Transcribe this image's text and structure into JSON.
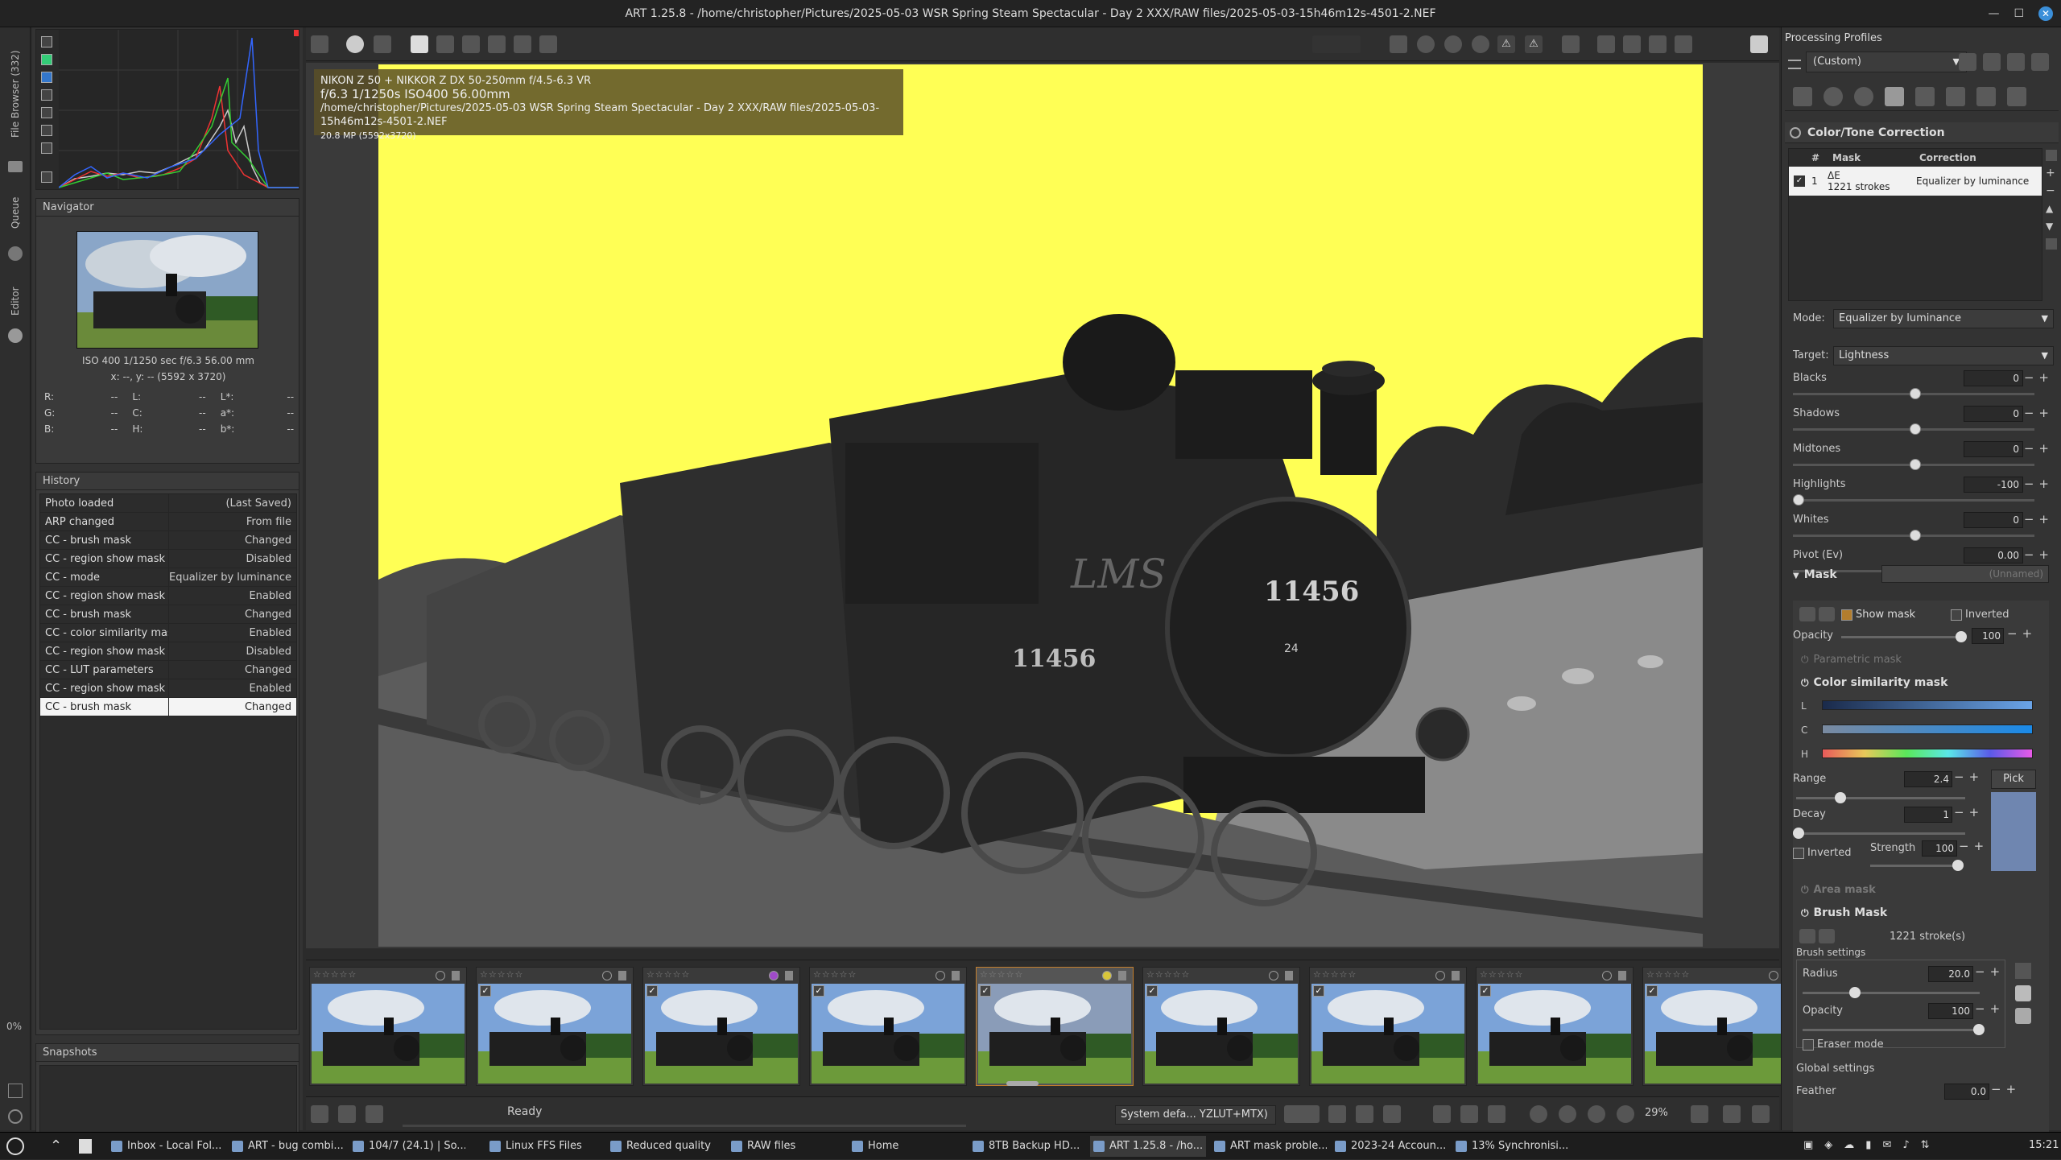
{
  "window": {
    "title": "ART 1.25.8 - /home/christopher/Pictures/2025-05-03 WSR Spring Steam Spectacular - Day 2 XXX/RAW files/2025-05-03-15h46m12s-4501-2.NEF"
  },
  "vtabs": {
    "file_browser": "File Browser (332)",
    "queue": "Queue",
    "editor": "Editor",
    "percent": "0%"
  },
  "navigator": {
    "title": "Navigator",
    "exif": "ISO 400   1/1250 sec   f/6.3   56.00 mm",
    "coords": "x: --, y: --     (5592 x 3720)",
    "rows": [
      {
        "a": "R:",
        "av": "--",
        "b": "L:",
        "bv": "--",
        "c": "L*:",
        "cv": "--"
      },
      {
        "a": "G:",
        "av": "--",
        "b": "C:",
        "bv": "--",
        "c": "a*:",
        "cv": "--"
      },
      {
        "a": "B:",
        "av": "--",
        "b": "H:",
        "bv": "--",
        "c": "b*:",
        "cv": "--"
      }
    ]
  },
  "history": {
    "title": "History",
    "rows": [
      {
        "a": "Photo loaded",
        "b": "(Last Saved)"
      },
      {
        "a": "ARP changed",
        "b": "From file"
      },
      {
        "a": "CC - brush mask",
        "b": "Changed"
      },
      {
        "a": "CC - region show mask",
        "b": "Disabled"
      },
      {
        "a": "CC - mode",
        "b": "Equalizer by luminance"
      },
      {
        "a": "CC - region show mask",
        "b": "Enabled"
      },
      {
        "a": "CC - brush mask",
        "b": "Changed"
      },
      {
        "a": "CC - color similarity mask",
        "b": "Enabled"
      },
      {
        "a": "CC - region show mask",
        "b": "Disabled"
      },
      {
        "a": "CC - LUT parameters",
        "b": "Changed"
      },
      {
        "a": "CC - region show mask",
        "b": "Enabled"
      },
      {
        "a": "CC - brush mask",
        "b": "Changed"
      }
    ]
  },
  "snapshots": {
    "title": "Snapshots",
    "add": "+",
    "remove": "—"
  },
  "infobox": {
    "camera": "NIKON Z 50 + NIKKOR Z DX 50-250mm f/4.5-6.3 VR",
    "exposure": "f/6.3  1/1250s  ISO400  56.00mm",
    "path": "/home/christopher/Pictures/2025-05-03 WSR Spring Steam Spectacular - Day 2 XXX/RAW files/2025-05-03-15h46m12s-4501-2.NEF",
    "size": "20.8 MP (5592x3720)"
  },
  "photo": {
    "loco_number": "11456",
    "loco_text": "LMS",
    "smokebox_plate": "24"
  },
  "statusbar": {
    "status": "Ready",
    "profile": "System defa... YZLUT+MTX)",
    "zoom": "29%"
  },
  "right": {
    "processing_profiles": "Processing Profiles",
    "profile_value": "(Custom)",
    "section_title": "Color/Tone Correction",
    "mask_table": {
      "col_hash": "#",
      "col_mask": "Mask",
      "col_corr": "Correction",
      "row_num": "1",
      "row_mask1": "ΔE",
      "row_mask2": "1221 strokes",
      "row_corr": "Equalizer by luminance"
    },
    "mode_label": "Mode:",
    "mode_value": "Equalizer by luminance",
    "target_label": "Target:",
    "target_value": "Lightness",
    "sliders": [
      {
        "label": "Blacks",
        "value": "0",
        "pos": 0.5
      },
      {
        "label": "Shadows",
        "value": "0",
        "pos": 0.5
      },
      {
        "label": "Midtones",
        "value": "0",
        "pos": 0.5
      },
      {
        "label": "Highlights",
        "value": "-100",
        "pos": 0.0
      },
      {
        "label": "Whites",
        "value": "0",
        "pos": 0.5
      },
      {
        "label": "Pivot (Ev)",
        "value": "0.00",
        "pos": 0.5
      }
    ],
    "mask_title": "Mask",
    "mask_name": "(Unnamed)",
    "show_mask": "Show mask",
    "inverted": "Inverted",
    "opacity_label": "Opacity",
    "opacity_value": "100",
    "parametric": "Parametric mask",
    "color_sim": "Color similarity mask",
    "L": "L",
    "C": "C",
    "H": "H",
    "range_label": "Range",
    "range_value": "2.4",
    "pick": "Pick",
    "decay_label": "Decay",
    "decay_value": "1",
    "inverted2": "Inverted",
    "strength_label": "Strength",
    "strength_value": "100",
    "area_mask": "Area mask",
    "brush_mask": "Brush Mask",
    "strokes": "1221 stroke(s)",
    "brush_settings": "Brush settings",
    "radius_label": "Radius",
    "radius_value": "20.0",
    "b_opacity_label": "Opacity",
    "b_opacity_value": "100",
    "eraser": "Eraser mode",
    "global_settings": "Global settings",
    "feather_label": "Feather",
    "feather_value": "0.0"
  },
  "taskbar": {
    "items": [
      "Inbox - Local Fol...",
      "ART - bug combi...",
      "104/7 (24.1) | So...",
      "Linux FFS Files",
      "Reduced quality",
      "RAW files",
      "Home",
      "8TB Backup HD...",
      "ART 1.25.8 - /ho...",
      "ART mask proble...",
      "2023-24 Accoun...",
      "13% Synchronisi..."
    ],
    "clock": "15:21"
  }
}
